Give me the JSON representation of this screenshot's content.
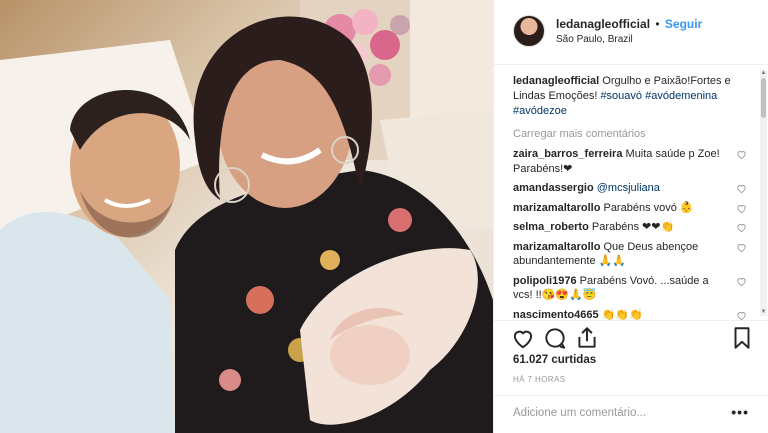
{
  "post": {
    "username": "ledanagleofficial",
    "follow_label": "Seguir",
    "separator": "•",
    "location": "São Paulo, Brazil",
    "caption_user": "ledanagleofficial",
    "caption_text": " Orgulho e Paixão!Fortes e Lindas Emoções! ",
    "caption_tags": [
      "#souavó",
      "#avódemenina",
      "#avódezoe"
    ],
    "load_more": "Carregar mais comentários",
    "likes": "61.027 curtidas",
    "time": "HÁ 7 HORAS",
    "add_comment_placeholder": "Adicione um comentário...",
    "more_label": "•••"
  },
  "comments": [
    {
      "user": "zaira_barros_ferreira",
      "text": " Muita saúde p Zoe! Parabéns!❤"
    },
    {
      "user": "amandassergio",
      "text": " ",
      "mention": "@mcsjuliana"
    },
    {
      "user": "marizamaltarollo",
      "text": " Parabéns vovó 👶"
    },
    {
      "user": "selma_roberto",
      "text": " Parabéns ❤❤👏"
    },
    {
      "user": "marizamaltarollo",
      "text": " Que Deus abençoe abundantemente 🙏🙏"
    },
    {
      "user": "polipoli1976",
      "text": " Parabéns Vovó. ...saúde a vcs! !!😘😍🙏😇"
    },
    {
      "user": "nascimento4665",
      "text": " 👏👏👏"
    }
  ],
  "icons": {
    "like": "heart-icon",
    "comment": "comment-icon",
    "share": "share-icon",
    "save": "bookmark-icon"
  },
  "colors": {
    "link": "#3897f0",
    "hashtag": "#003569",
    "muted": "#999999"
  }
}
